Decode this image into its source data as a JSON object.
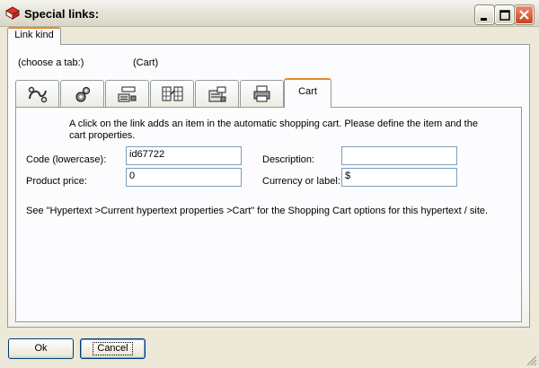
{
  "window": {
    "title": "Special links:"
  },
  "outer_tab": {
    "label": "Link kind"
  },
  "header": {
    "choose_label": "(choose a tab:)",
    "current_kind": "(Cart)"
  },
  "inner_tabs": [
    {
      "icon": "link-anchor-icon"
    },
    {
      "icon": "gears-icon"
    },
    {
      "icon": "window-list-icon"
    },
    {
      "icon": "grid-link-icon"
    },
    {
      "icon": "popup-window-icon"
    },
    {
      "icon": "print-icon"
    },
    {
      "label": "Cart",
      "active": true
    }
  ],
  "cart": {
    "description": "A click on the link adds an item in the automatic shopping cart. Please define the item and the cart properties.",
    "code_label": "Code (lowercase):",
    "code_value": "id67722",
    "description_label": "Description:",
    "description_value": "",
    "price_label": "Product price:",
    "price_value": "0",
    "currency_label": "Currency or label:",
    "currency_value": "$",
    "note": "See \"Hypertext >Current hypertext properties >Cart\" for the Shopping Cart options for this hypertext / site."
  },
  "buttons": {
    "ok": "Ok",
    "cancel": "Cancel"
  },
  "colors": {
    "tab_accent": "#e68b2c",
    "field_border": "#7f9db9",
    "dialog_bg": "#ece9d8"
  }
}
